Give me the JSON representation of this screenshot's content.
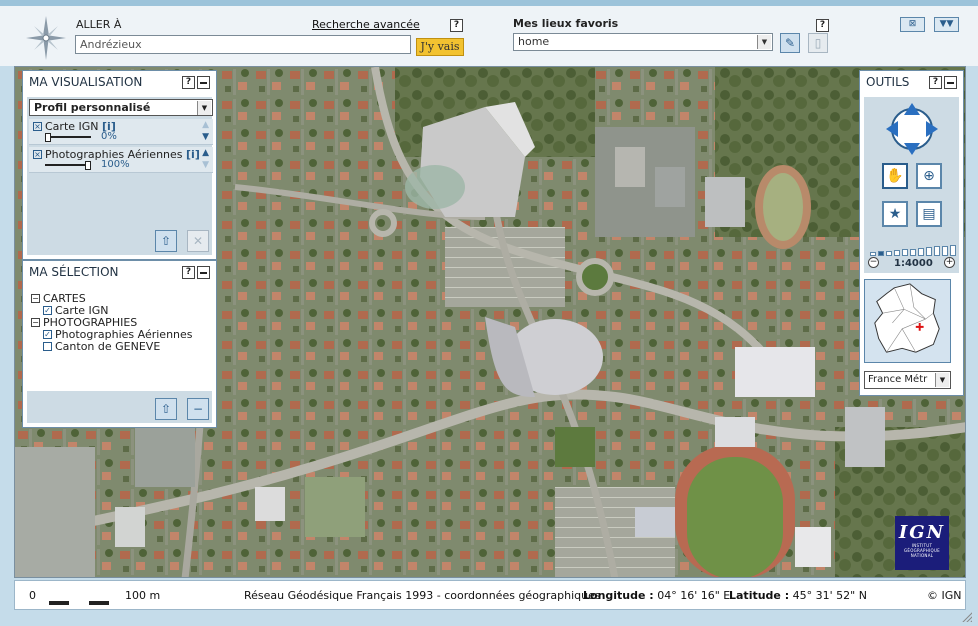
{
  "header": {
    "aller_label": "ALLER À",
    "aller_value": "Andrézieux",
    "recherche_link": "Recherche avancée",
    "go_button": "J'y vais",
    "favoris_label": "Mes lieux favoris",
    "favoris_value": "home",
    "help": "?"
  },
  "visualisation": {
    "title": "MA VISUALISATION",
    "profile": "Profil personnalisé",
    "layers": [
      {
        "name": "Carte IGN",
        "info": "[i]",
        "opacity": "0%",
        "opacity_value": 0
      },
      {
        "name": "Photographies Aériennes",
        "info": "[i]",
        "opacity": "100%",
        "opacity_value": 1
      }
    ]
  },
  "selection": {
    "title": "MA SÉLECTION",
    "groups": [
      {
        "name": "CARTES",
        "items": [
          {
            "name": "Carte IGN",
            "checked": true
          }
        ]
      },
      {
        "name": "PHOTOGRAPHIES",
        "items": [
          {
            "name": "Photographies Aériennes",
            "checked": true
          },
          {
            "name": "Canton de GENEVE",
            "checked": false
          }
        ]
      }
    ]
  },
  "tools": {
    "title": "OUTILS",
    "scale": "1:4000",
    "zoom_level": 1,
    "zoom_levels": 11,
    "region": "France Métr"
  },
  "status": {
    "scale_start": "0",
    "scale_end": "100 m",
    "reference": "Réseau Géodésique Français 1993 - coordonnées géographiques",
    "longitude_label": "Longitude :",
    "longitude_value": "04° 16' 16\" E",
    "latitude_label": "Latitude :",
    "latitude_value": "45° 31' 52\" N",
    "copyright": "© IGN"
  },
  "logo": {
    "text": "IGN",
    "subtext": "INSTITUT GÉOGRAPHIQUE NATIONAL"
  },
  "colors": {
    "accent": "#2a5d8c",
    "go_button": "#f2c230",
    "logo_bg": "#1b1d7a",
    "frame": "#c5dcea"
  },
  "icons": {
    "compass": "compass-rose-icon",
    "pin": "pin-icon",
    "trash": "trash-icon",
    "pan": "hand-icon",
    "zoom_box": "zoom-box-icon",
    "favorite": "star-icon",
    "print": "print-icon"
  }
}
